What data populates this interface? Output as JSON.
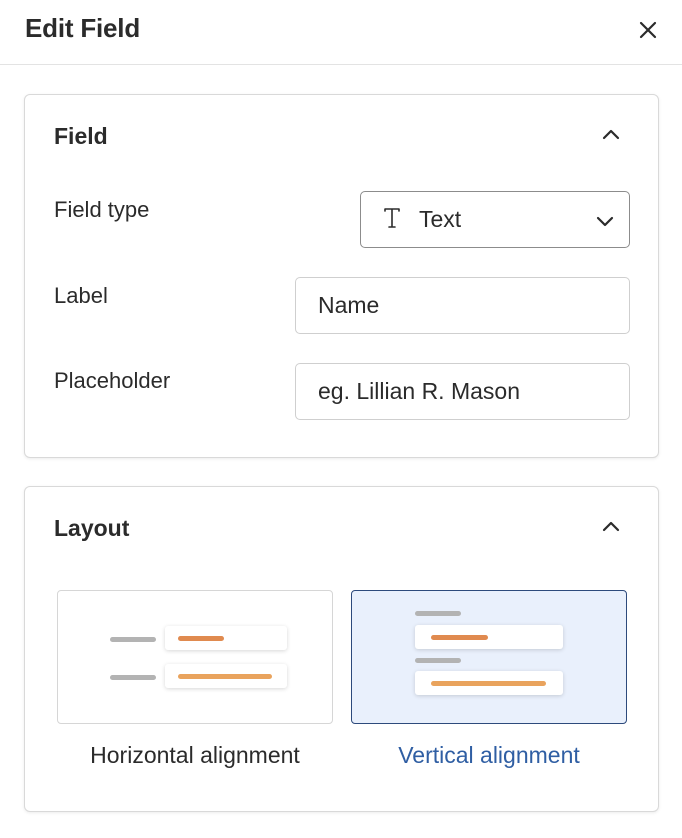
{
  "header": {
    "title": "Edit Field",
    "close_icon": "close-icon"
  },
  "field_section": {
    "title": "Field",
    "collapse_icon": "chevron-up-icon",
    "field_type": {
      "label": "Field type",
      "value": "Text",
      "icon": "text-type-icon"
    },
    "label_row": {
      "label": "Label",
      "value": "Name"
    },
    "placeholder_row": {
      "label": "Placeholder",
      "value": "eg. Lillian R. Mason"
    }
  },
  "layout_section": {
    "title": "Layout",
    "collapse_icon": "chevron-up-icon",
    "options": [
      {
        "label": "Horizontal alignment",
        "selected": false
      },
      {
        "label": "Vertical alignment",
        "selected": true
      }
    ]
  },
  "colors": {
    "selected_border": "#2d4a7c",
    "selected_background": "#e9f0fc",
    "selected_text": "#2f5ea3",
    "accent_orange": "#e08a4f"
  }
}
